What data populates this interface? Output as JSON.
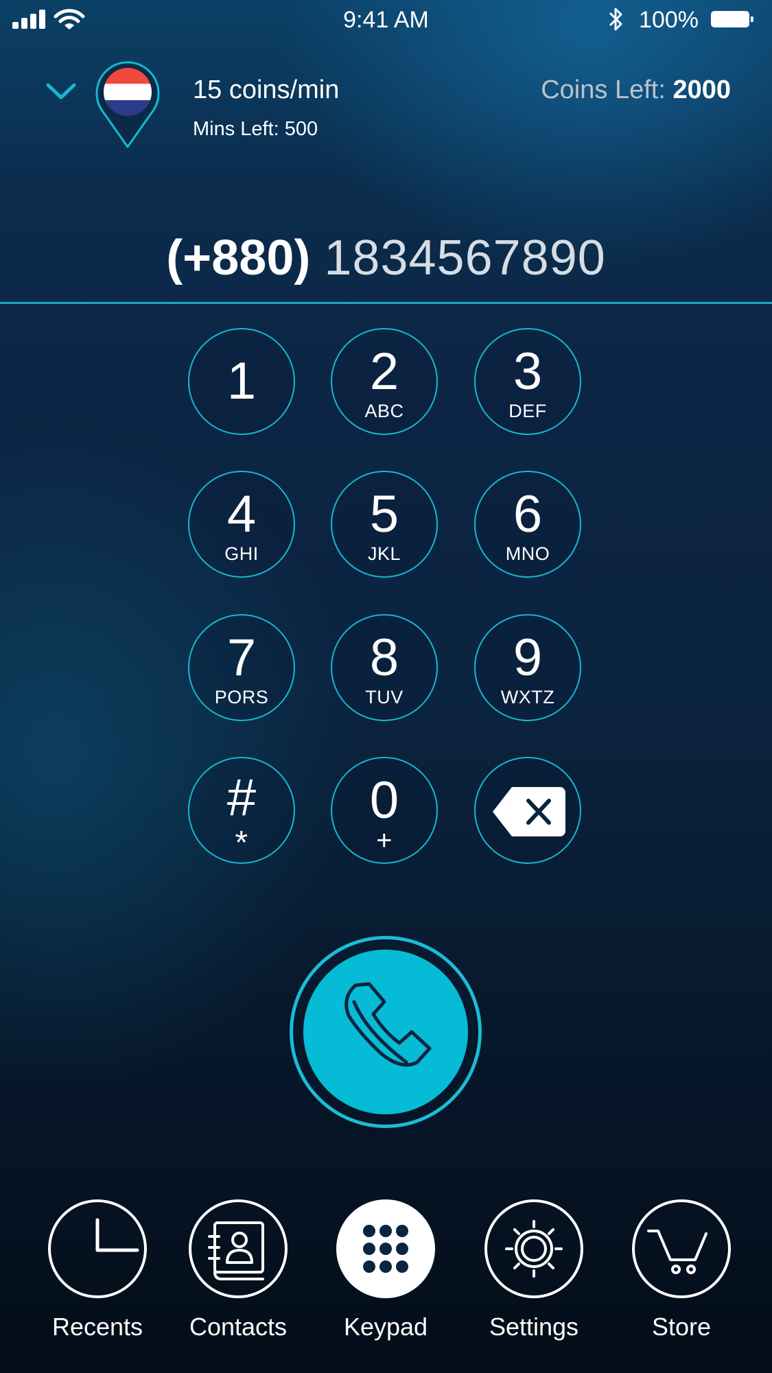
{
  "status_bar": {
    "time": "9:41 AM",
    "battery": "100%"
  },
  "header": {
    "rate": "15 coins/min",
    "mins_left_label": "Mins Left:",
    "mins_left_value": "500",
    "coins_left_label": "Coins Left:",
    "coins_left_value": "2000"
  },
  "dial": {
    "country_code": "(+880)",
    "number": "1834567890"
  },
  "keypad": [
    {
      "digit": "1",
      "letters": ""
    },
    {
      "digit": "2",
      "letters": "ABC"
    },
    {
      "digit": "3",
      "letters": "DEF"
    },
    {
      "digit": "4",
      "letters": "GHI"
    },
    {
      "digit": "5",
      "letters": "JKL"
    },
    {
      "digit": "6",
      "letters": "MNO"
    },
    {
      "digit": "7",
      "letters": "PORS"
    },
    {
      "digit": "8",
      "letters": "TUV"
    },
    {
      "digit": "9",
      "letters": "WXTZ"
    },
    {
      "digit": "#",
      "letters": "*"
    },
    {
      "digit": "0",
      "letters": "+"
    }
  ],
  "tabs": [
    {
      "label": "Recents",
      "icon": "clock-icon"
    },
    {
      "label": "Contacts",
      "icon": "contacts-book-icon"
    },
    {
      "label": "Keypad",
      "icon": "keypad-grid-icon"
    },
    {
      "label": "Settings",
      "icon": "gear-icon"
    },
    {
      "label": "Store",
      "icon": "cart-icon"
    }
  ],
  "colors": {
    "accent": "#15b8d2",
    "call_button": "#06bbd6",
    "flag_red": "#f04a3c",
    "flag_blue": "#2e3a8c"
  }
}
